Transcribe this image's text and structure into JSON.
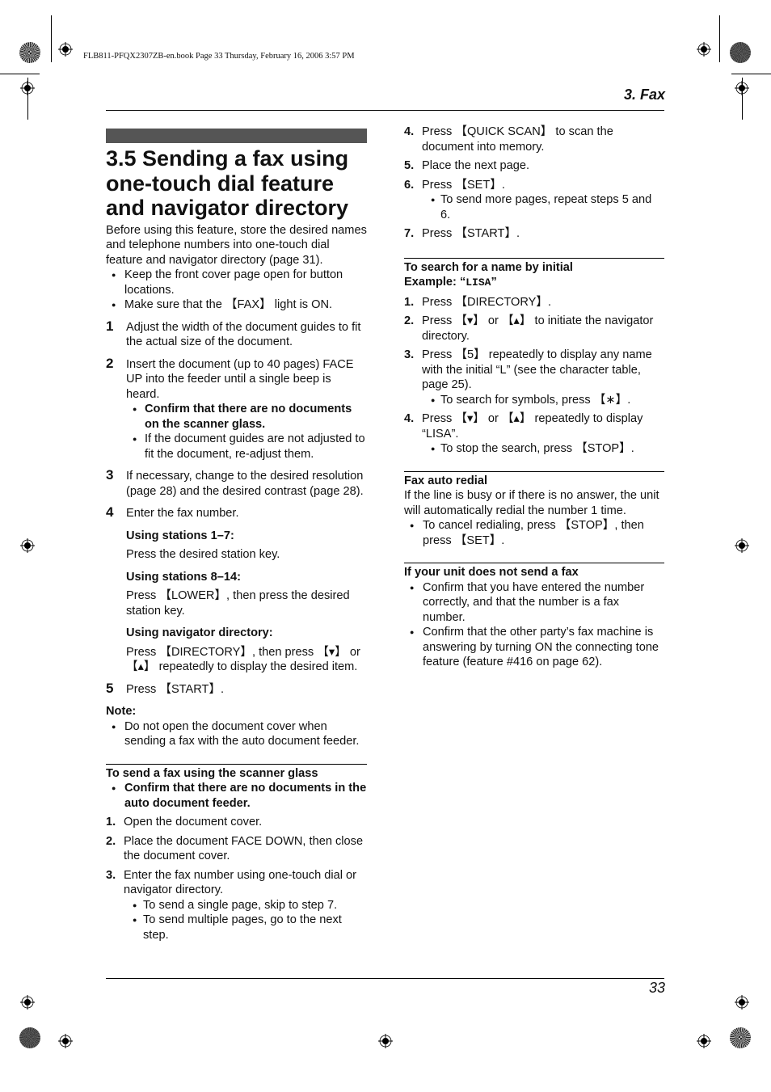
{
  "slug": "FLB811-PFQX2307ZB-en.book  Page 33  Thursday, February 16, 2006  3:57 PM",
  "chapter": "3. Fax",
  "page_number": "33",
  "title": "3.5 Sending a fax using one-touch dial feature and navigator directory",
  "intro": "Before using this feature, store the desired names and telephone numbers into one-touch dial feature and navigator directory (page 31).",
  "intro_bullets": [
    "Keep the front cover page open for button locations.",
    "Make sure that the 【FAX】 light is ON."
  ],
  "steps": [
    {
      "n": "1",
      "text": "Adjust the width of the document guides to fit the actual size of the document."
    },
    {
      "n": "2",
      "text": "Insert the document (up to 40 pages) FACE UP into the feeder until a single beep is heard.",
      "bullets": [
        "Confirm that there are no documents on the scanner glass.",
        "If the document guides are not adjusted to fit the document, re-adjust them."
      ]
    },
    {
      "n": "3",
      "text": "If necessary, change to the desired resolution (page 28) and the desired contrast (page 28)."
    },
    {
      "n": "4",
      "text": "Enter the fax number.",
      "sub": [
        {
          "heading": "Using stations 1–7:",
          "text": "Press the desired station key."
        },
        {
          "heading": "Using stations 8–14:",
          "text": "Press 【LOWER】, then press the desired station key."
        },
        {
          "heading": "Using navigator directory:",
          "text": "Press 【DIRECTORY】, then press 【▾】 or 【▴】 repeatedly to display the desired item."
        }
      ]
    },
    {
      "n": "5",
      "text": "Press 【START】."
    }
  ],
  "note": {
    "label": "Note:",
    "bullets": [
      "Do not open the document cover when sending a fax with the auto document feeder."
    ]
  },
  "scanner_glass": {
    "heading": "To send a fax using the scanner glass",
    "bold_bullet": "Confirm that there are no documents in the auto document feeder.",
    "steps": [
      {
        "n": "1.",
        "text": "Open the document cover."
      },
      {
        "n": "2.",
        "text": "Place the document FACE DOWN, then close the document cover."
      },
      {
        "n": "3.",
        "text": "Enter the fax number using one-touch dial or navigator directory.",
        "bullets": [
          "To send a single page, skip to step 7.",
          "To send multiple pages, go to the next step."
        ]
      },
      {
        "n": "4.",
        "text": "Press 【QUICK SCAN】 to scan the document into memory."
      },
      {
        "n": "5.",
        "text": "Place the next page."
      },
      {
        "n": "6.",
        "text": "Press 【SET】.",
        "bullets": [
          "To send more pages, repeat steps 5 and 6."
        ]
      },
      {
        "n": "7.",
        "text": "Press 【START】."
      }
    ]
  },
  "search_initial": {
    "heading": "To search for a name by initial",
    "example_label": "Example: “",
    "example_value": "LISA",
    "example_close": "”",
    "steps": [
      {
        "n": "1.",
        "text": "Press 【DIRECTORY】."
      },
      {
        "n": "2.",
        "text": "Press 【▾】 or 【▴】 to initiate the navigator directory."
      },
      {
        "n": "3.",
        "text": "Press 【5】 repeatedly to display any name with the initial “L” (see the character table, page 25).",
        "bullets": [
          "To search for symbols, press 【∗】."
        ]
      },
      {
        "n": "4.",
        "text": "Press 【▾】 or 【▴】 repeatedly to display “LISA”.",
        "bullets": [
          "To stop the search, press 【STOP】."
        ]
      }
    ]
  },
  "auto_redial": {
    "heading": "Fax auto redial",
    "text": "If the line is busy or if there is no answer, the unit will automatically redial the number 1 time.",
    "bullets": [
      "To cancel redialing, press 【STOP】, then press 【SET】."
    ]
  },
  "not_send": {
    "heading": "If your unit does not send a fax",
    "bullets": [
      "Confirm that you have entered the number correctly, and that the number is a fax number.",
      "Confirm that the other party’s fax machine is answering by turning ON the connecting tone feature (feature #416 on page 62)."
    ]
  }
}
